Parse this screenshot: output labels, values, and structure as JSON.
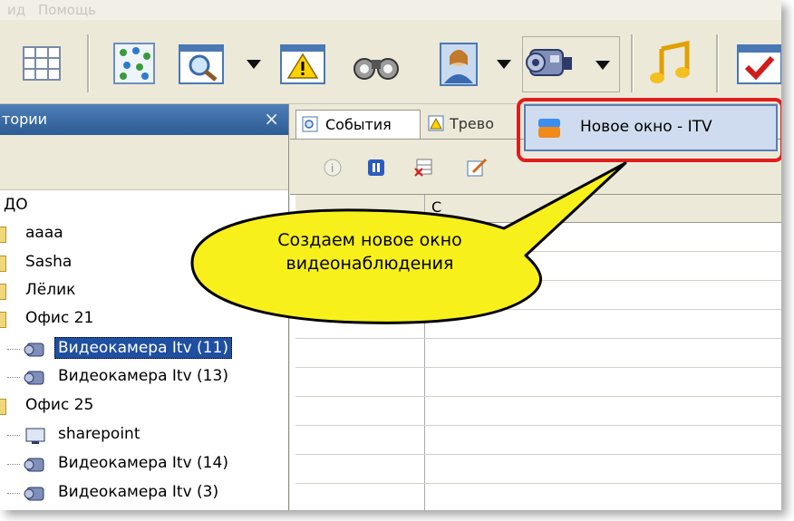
{
  "menubar": {
    "items": [
      "ид",
      "Помощь"
    ]
  },
  "toolbar": {
    "buttons": [
      "grid-layout",
      "map",
      "search",
      "alarm",
      "binoculars",
      "user",
      "camera",
      "music",
      "calendar-check"
    ]
  },
  "left_panel": {
    "title": "тории",
    "tree": [
      {
        "label": "ДО",
        "kind": "root"
      },
      {
        "label": "аааа",
        "kind": "folder"
      },
      {
        "label": "Sasha",
        "kind": "folder"
      },
      {
        "label": "Лёлик",
        "kind": "folder"
      },
      {
        "label": "Офис 21",
        "kind": "folder"
      },
      {
        "label": "Видеокамера Itv (11)",
        "kind": "camera",
        "selected": true
      },
      {
        "label": "Видеокамера Itv (13)",
        "kind": "camera"
      },
      {
        "label": "Офис 25",
        "kind": "folder"
      },
      {
        "label": "sharepoint",
        "kind": "monitor"
      },
      {
        "label": "Видеокамера Itv (14)",
        "kind": "camera"
      },
      {
        "label": "Видеокамера Itv (3)",
        "kind": "camera"
      }
    ]
  },
  "right_panel": {
    "tabs": [
      {
        "label": "События",
        "active": true
      },
      {
        "label": "Трево",
        "active": false
      }
    ],
    "grid_header_fragment": "С"
  },
  "popup_menu": {
    "item": "Новое окно - ITV"
  },
  "callout": {
    "line1": "Создаем новое окно",
    "line2": "видеонаблюдения"
  },
  "colors": {
    "highlight_red": "#e01d1d",
    "callout_yellow": "#f8f01a",
    "title_blue": "#2c5b94"
  }
}
